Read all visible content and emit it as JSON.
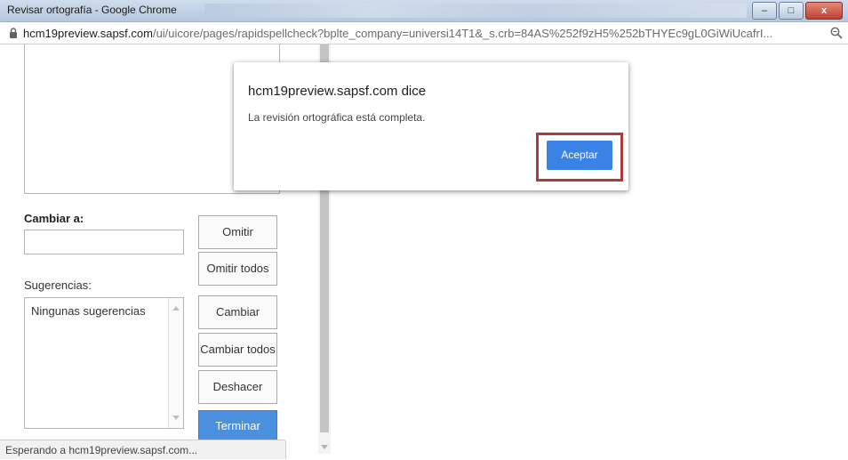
{
  "window": {
    "title": "Revisar ortografía - Google Chrome",
    "minimize_glyph": "–",
    "maximize_glyph": "□",
    "close_glyph": "x"
  },
  "address": {
    "domain": "hcm19preview.sapsf.com",
    "path": "/ui/uicore/pages/rapidspellcheck?bplte_company=universi14T1&_s.crb=84AS%252f9zH5%252bTHYEc9gL0GiWiUcafrI..."
  },
  "spellcheck": {
    "change_to_label": "Cambiar a:",
    "change_to_value": "",
    "suggestions_label": "Sugerencias:",
    "suggestions": [
      "Ningunas sugerencias"
    ],
    "buttons": {
      "ignore": "Omitir",
      "ignore_all": "Omitir todos",
      "change": "Cambiar",
      "change_all": "Cambiar todos",
      "undo": "Deshacer",
      "finish": "Terminar"
    }
  },
  "status": {
    "text": "Esperando a hcm19preview.sapsf.com..."
  },
  "dialog": {
    "title": "hcm19preview.sapsf.com dice",
    "message": "La revisión ortográfica está completa.",
    "accept_label": "Aceptar"
  },
  "colors": {
    "accept_button": "#3b82e6",
    "highlight_border": "#b03a3a",
    "finish_button": "#4b8fdf"
  }
}
